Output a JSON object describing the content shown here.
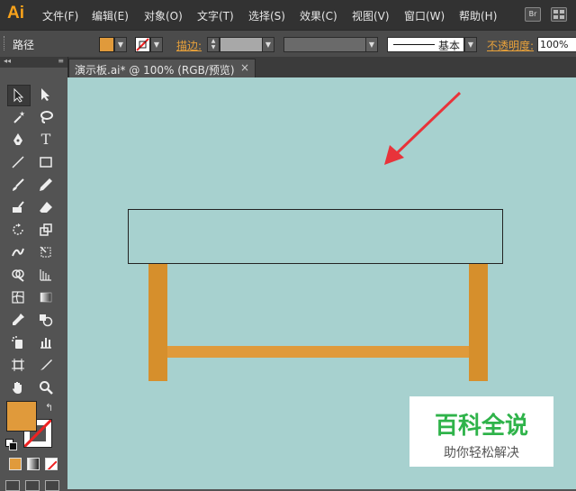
{
  "app": {
    "logo": "Ai",
    "br_label": "Br"
  },
  "menu": [
    "文件(F)",
    "编辑(E)",
    "对象(O)",
    "文字(T)",
    "选择(S)",
    "效果(C)",
    "视图(V)",
    "窗口(W)",
    "帮助(H)"
  ],
  "control_bar": {
    "selection_type": "路径",
    "fill_color": "#e09a3b",
    "stroke_label": "描边:",
    "brush_label": "基本",
    "opacity_label": "不透明度:",
    "opacity_value": "100%"
  },
  "document_tab": {
    "title": "演示板.ai* @ 100% (RGB/预览)",
    "close": "×"
  },
  "tools": {
    "fill_color": "#e09a3b",
    "type_tool_glyph": "T"
  },
  "canvas": {
    "background": "#a7d1cf",
    "tabletop_fill": "#a7d1cf",
    "leg_color": "#d68f2c",
    "arrow_color": "#e8333a"
  },
  "watermark": {
    "title": "百科全说",
    "subtitle": "助你轻松解决"
  }
}
